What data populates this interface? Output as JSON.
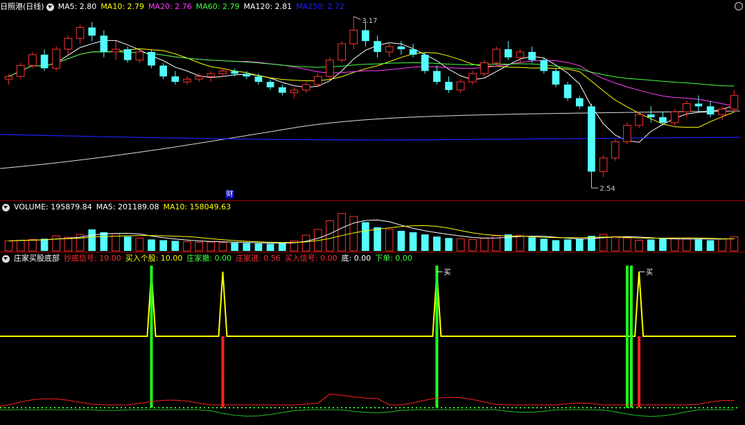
{
  "stock": {
    "name": "日照港",
    "period": "(日线)"
  },
  "main_legend": [
    {
      "key": "ma5",
      "label": "MA5: ",
      "value": "2.80",
      "color": "#ffffff"
    },
    {
      "key": "ma10",
      "label": "MA10: ",
      "value": "2.79",
      "color": "#ffff00"
    },
    {
      "key": "ma20",
      "label": "MA20: ",
      "value": "2.76",
      "color": "#ff40ff"
    },
    {
      "key": "ma60",
      "label": "MA60: ",
      "value": "2.79",
      "color": "#40ff40"
    },
    {
      "key": "ma120",
      "label": "MA120: ",
      "value": "2.81",
      "color": "#ffffff"
    },
    {
      "key": "ma250",
      "label": "MA250: ",
      "value": "2.72",
      "color": "#2020ff"
    }
  ],
  "price_marks": {
    "high": "3.17",
    "low": "2.54"
  },
  "finance_badge": "财",
  "volume_legend": [
    {
      "key": "volume",
      "label": "VOLUME: ",
      "value": "195879.84",
      "color": "#ffffff"
    },
    {
      "key": "vma5",
      "label": "MA5: ",
      "value": "201189.08",
      "color": "#ffffff"
    },
    {
      "key": "vma10",
      "label": "MA10: ",
      "value": "158049.63",
      "color": "#ffff00"
    }
  ],
  "indicator": {
    "name": "庄家买股底部",
    "legend": [
      {
        "key": "chaodi",
        "label": "抄底信号: ",
        "value": "10.00",
        "color": "#ff3030"
      },
      {
        "key": "mairu",
        "label": "买入个股: ",
        "value": "10.00",
        "color": "#ffff00"
      },
      {
        "key": "chedi",
        "label": "庄家撤: ",
        "value": "0.00",
        "color": "#40ff40"
      },
      {
        "key": "jin",
        "label": "庄家进: ",
        "value": "0.56",
        "color": "#ff3030"
      },
      {
        "key": "xinhao",
        "label": "买入信号: ",
        "value": "0.00",
        "color": "#ff3030"
      },
      {
        "key": "di",
        "label": "底: ",
        "value": "0.00",
        "color": "#ffffff"
      },
      {
        "key": "xiadan",
        "label": "下单: ",
        "value": "0.00",
        "color": "#40ff40"
      }
    ],
    "buy_label": "买"
  },
  "colors": {
    "up": "#ff3232",
    "down": "#54fcfc",
    "background": "#000000",
    "divider": "#a00000"
  },
  "chart_data": {
    "type": "candlestick",
    "price_high": 3.17,
    "price_low": 2.54,
    "ohlc": [
      [
        2.94,
        2.96,
        2.92,
        2.95
      ],
      [
        2.95,
        3.0,
        2.94,
        2.99
      ],
      [
        2.99,
        3.04,
        2.98,
        3.03
      ],
      [
        3.03,
        3.05,
        2.97,
        2.98
      ],
      [
        2.98,
        3.06,
        2.97,
        3.05
      ],
      [
        3.05,
        3.1,
        3.03,
        3.09
      ],
      [
        3.09,
        3.14,
        3.07,
        3.13
      ],
      [
        3.13,
        3.15,
        3.08,
        3.1
      ],
      [
        3.1,
        3.12,
        3.02,
        3.04
      ],
      [
        3.04,
        3.08,
        3.01,
        3.05
      ],
      [
        3.05,
        3.06,
        3.0,
        3.01
      ],
      [
        3.01,
        3.05,
        3.0,
        3.04
      ],
      [
        3.04,
        3.05,
        2.98,
        2.99
      ],
      [
        2.99,
        3.0,
        2.94,
        2.95
      ],
      [
        2.95,
        2.97,
        2.92,
        2.93
      ],
      [
        2.93,
        2.95,
        2.92,
        2.94
      ],
      [
        2.94,
        2.96,
        2.93,
        2.95
      ],
      [
        2.95,
        2.97,
        2.93,
        2.96
      ],
      [
        2.96,
        2.98,
        2.95,
        2.97
      ],
      [
        2.97,
        2.98,
        2.95,
        2.96
      ],
      [
        2.96,
        2.97,
        2.94,
        2.95
      ],
      [
        2.95,
        2.96,
        2.92,
        2.93
      ],
      [
        2.93,
        2.94,
        2.9,
        2.91
      ],
      [
        2.91,
        2.92,
        2.88,
        2.89
      ],
      [
        2.89,
        2.91,
        2.87,
        2.9
      ],
      [
        2.9,
        2.93,
        2.89,
        2.92
      ],
      [
        2.92,
        2.96,
        2.91,
        2.95
      ],
      [
        2.95,
        3.02,
        2.94,
        3.01
      ],
      [
        3.01,
        3.08,
        3.0,
        3.07
      ],
      [
        3.07,
        3.17,
        3.05,
        3.12
      ],
      [
        3.12,
        3.15,
        3.06,
        3.08
      ],
      [
        3.08,
        3.1,
        3.02,
        3.04
      ],
      [
        3.04,
        3.07,
        3.02,
        3.06
      ],
      [
        3.06,
        3.08,
        3.03,
        3.05
      ],
      [
        3.05,
        3.07,
        3.02,
        3.03
      ],
      [
        3.03,
        3.04,
        2.96,
        2.97
      ],
      [
        2.97,
        2.99,
        2.92,
        2.93
      ],
      [
        2.93,
        2.95,
        2.89,
        2.9
      ],
      [
        2.9,
        2.94,
        2.89,
        2.93
      ],
      [
        2.93,
        2.97,
        2.92,
        2.96
      ],
      [
        2.96,
        3.01,
        2.95,
        3.0
      ],
      [
        3.0,
        3.06,
        2.99,
        3.05
      ],
      [
        3.05,
        3.08,
        3.01,
        3.02
      ],
      [
        3.02,
        3.05,
        3.0,
        3.04
      ],
      [
        3.04,
        3.06,
        3.0,
        3.01
      ],
      [
        3.01,
        3.02,
        2.96,
        2.97
      ],
      [
        2.97,
        2.98,
        2.91,
        2.92
      ],
      [
        2.92,
        2.93,
        2.86,
        2.87
      ],
      [
        2.87,
        2.88,
        2.83,
        2.84
      ],
      [
        2.84,
        2.85,
        2.54,
        2.6
      ],
      [
        2.6,
        2.66,
        2.58,
        2.65
      ],
      [
        2.65,
        2.72,
        2.64,
        2.71
      ],
      [
        2.71,
        2.78,
        2.7,
        2.77
      ],
      [
        2.77,
        2.82,
        2.76,
        2.81
      ],
      [
        2.81,
        2.84,
        2.78,
        2.8
      ],
      [
        2.8,
        2.82,
        2.77,
        2.78
      ],
      [
        2.78,
        2.83,
        2.77,
        2.82
      ],
      [
        2.82,
        2.86,
        2.8,
        2.85
      ],
      [
        2.85,
        2.88,
        2.82,
        2.84
      ],
      [
        2.84,
        2.86,
        2.8,
        2.81
      ],
      [
        2.81,
        2.84,
        2.79,
        2.83
      ],
      [
        2.83,
        2.9,
        2.82,
        2.88
      ]
    ],
    "volume": [
      140,
      150,
      160,
      170,
      210,
      190,
      230,
      300,
      260,
      240,
      200,
      180,
      160,
      150,
      140,
      130,
      120,
      125,
      120,
      115,
      110,
      105,
      100,
      110,
      140,
      220,
      300,
      420,
      520,
      480,
      400,
      330,
      300,
      280,
      260,
      230,
      200,
      180,
      170,
      160,
      180,
      210,
      230,
      220,
      190,
      170,
      150,
      160,
      170,
      210,
      230,
      200,
      180,
      150,
      160,
      170,
      180,
      170,
      160,
      150,
      170,
      196
    ],
    "signals": {
      "green_bars": [
        12,
        36,
        52
      ],
      "red_bars": [
        18,
        53
      ],
      "yellow_peaks": [
        12,
        18,
        36,
        53
      ]
    }
  }
}
